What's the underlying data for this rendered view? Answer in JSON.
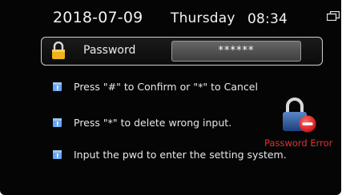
{
  "status_bar": {
    "date": "2018-07-09",
    "weekday": "Thursday",
    "time": "08:34"
  },
  "password_row": {
    "label": "Password",
    "value": "******"
  },
  "info_lines": [
    "Press \"#\" to Confirm or \"*\" to Cancel",
    "Press \"*\" to delete wrong input.",
    "Input the pwd to enter the setting system."
  ],
  "error": {
    "message": "Password Error"
  },
  "icons": {
    "window": "window-restore-icon",
    "lock": "lock-icon",
    "info": "info-note-icon",
    "error": "padlock-error-icon"
  },
  "colors": {
    "background": "#050505",
    "text": "#e8e8e8",
    "error": "#e23232",
    "lock_gold": "#f0b21a"
  }
}
